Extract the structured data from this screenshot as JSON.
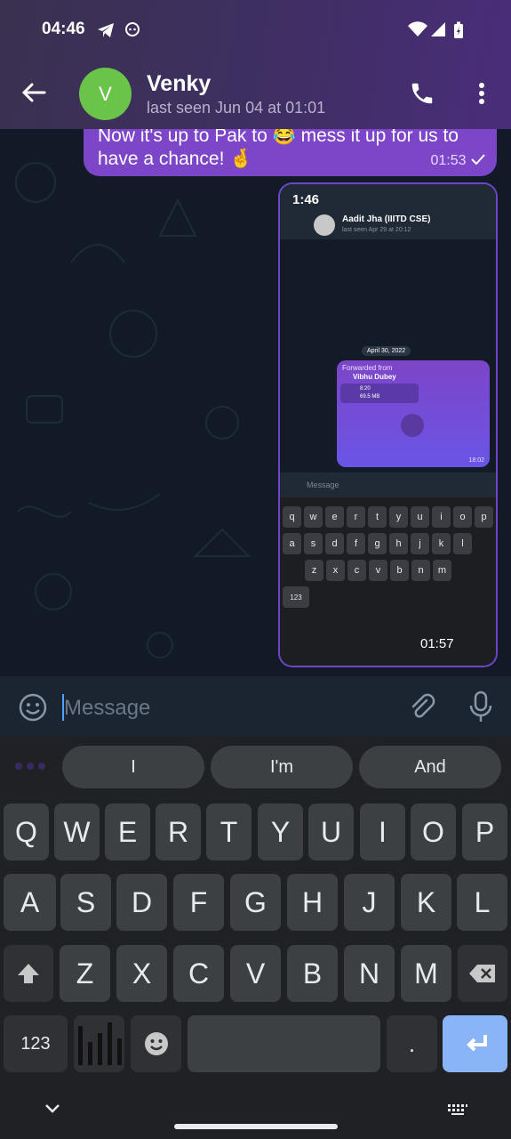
{
  "status_bar": {
    "time": "04:46",
    "icons": [
      "telegram-icon",
      "ghost-icon",
      "wifi-icon",
      "signal-icon",
      "battery-icon"
    ]
  },
  "header": {
    "avatar_letter": "V",
    "name": "Venky",
    "last_seen": "last seen Jun 04 at 01:01"
  },
  "messages": [
    {
      "text": "Now it's up to Pak to 😂 mess it up for us to have a chance! 🤞",
      "time": "01:53"
    },
    {
      "type": "screenshot",
      "time": "01:57",
      "screenshot": {
        "time": "1:46",
        "contact": "Aadit Jha (IIITD CSE)",
        "last_seen": "last seen Apr 29 at 20:12",
        "date": "April 30, 2022",
        "forwarded_label": "Forwarded from",
        "forwarded_from": "Vibhu Dubey",
        "file_duration": "8:20",
        "file_size": "69.5 MB",
        "msg_time": "18:02",
        "input_placeholder": "Message",
        "keys_row1": [
          "q",
          "w",
          "e",
          "r",
          "t",
          "y",
          "u",
          "i",
          "o",
          "p"
        ],
        "keys_row2": [
          "a",
          "s",
          "d",
          "f",
          "g",
          "h",
          "j",
          "k",
          "l"
        ],
        "keys_row3": [
          "z",
          "x",
          "c",
          "v",
          "b",
          "n",
          "m"
        ],
        "key_123": "123"
      }
    }
  ],
  "input": {
    "placeholder": "Message"
  },
  "keyboard": {
    "suggestions": [
      "I",
      "I'm",
      "And"
    ],
    "row1": [
      "Q",
      "W",
      "E",
      "R",
      "T",
      "Y",
      "U",
      "I",
      "O",
      "P"
    ],
    "row2": [
      "A",
      "S",
      "D",
      "F",
      "G",
      "H",
      "J",
      "K",
      "L"
    ],
    "row3": [
      "Z",
      "X",
      "C",
      "V",
      "B",
      "N",
      "M"
    ],
    "key_123": "123",
    "key_period": "."
  },
  "colors": {
    "accent": "#7d45c8",
    "enter_key": "#8ab4f8",
    "avatar": "#6bc44a"
  }
}
